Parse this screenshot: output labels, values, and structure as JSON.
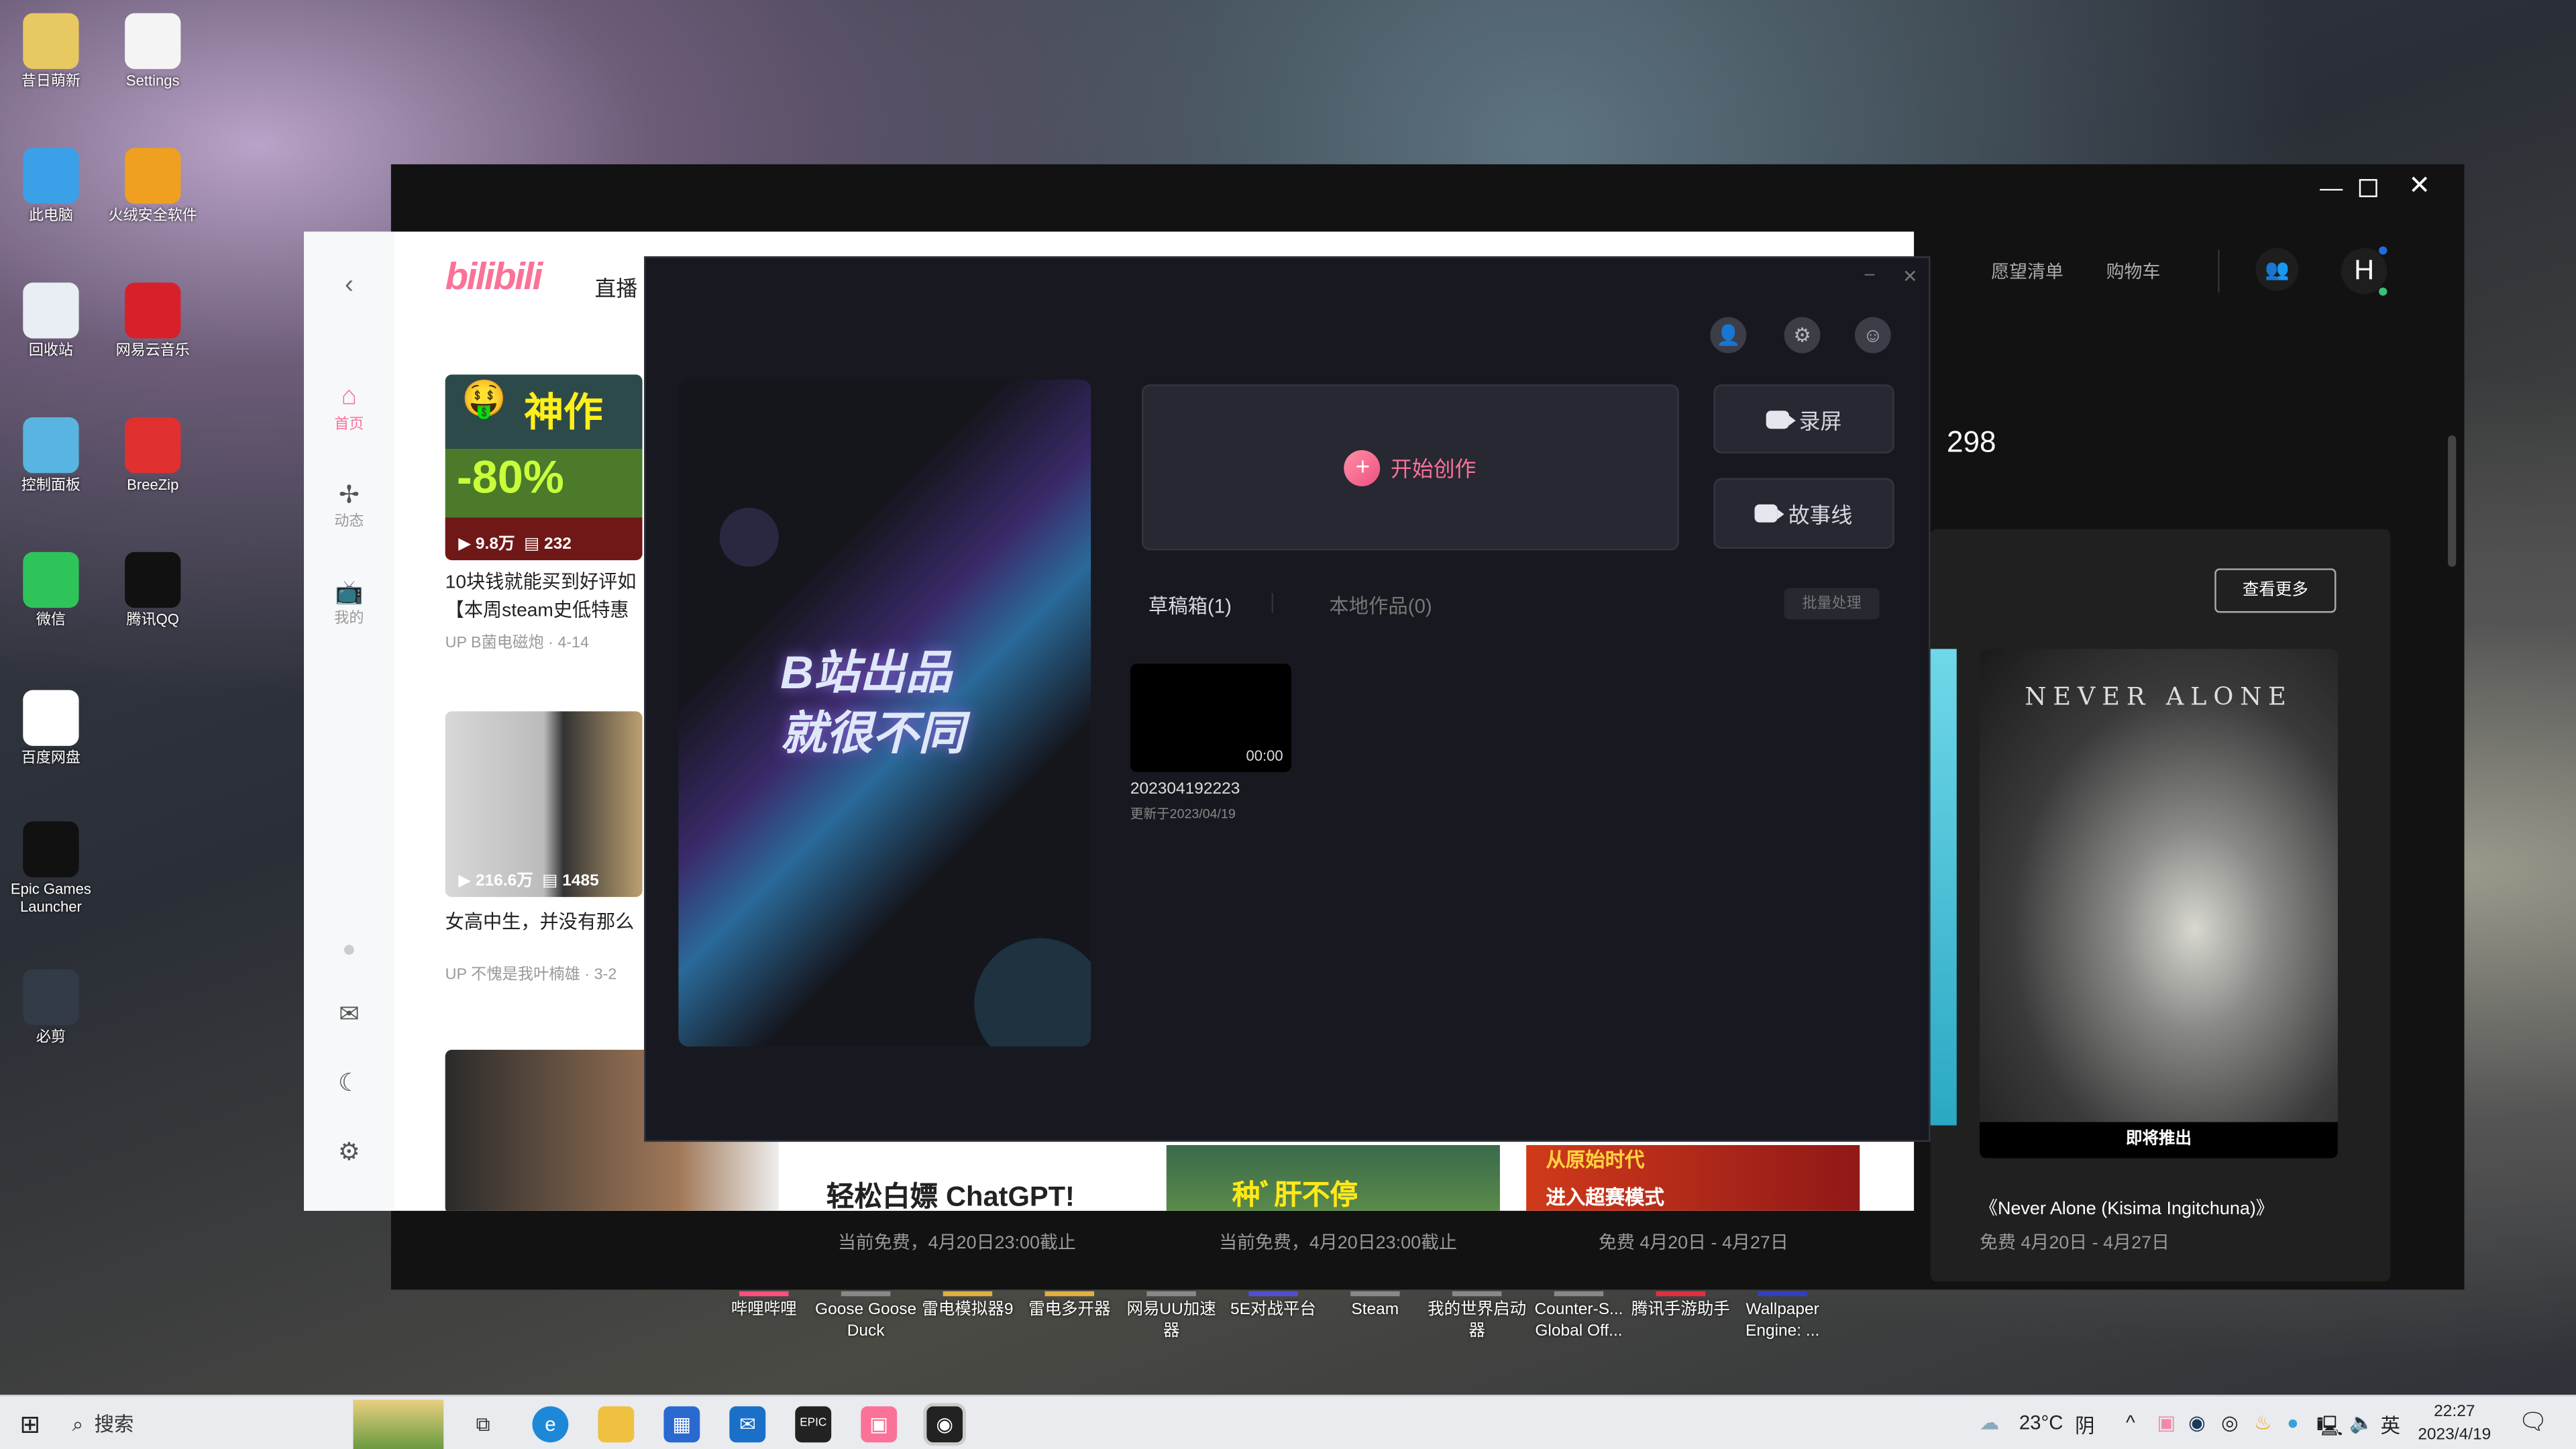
{
  "desktop": {
    "icons": [
      {
        "label": "昔日萌新",
        "color": "#e8c860"
      },
      {
        "label": "Settings",
        "color": "#f4f4f4"
      },
      {
        "label": "此电脑",
        "color": "#3aa0e8"
      },
      {
        "label": "火绒安全软件",
        "color": "#f0a020"
      },
      {
        "label": "回收站",
        "color": "#e8eef4"
      },
      {
        "label": "网易云音乐",
        "color": "#d8202a"
      },
      {
        "label": "控制面板",
        "color": "#58b4e0"
      },
      {
        "label": "BreeZip",
        "color": "#e03030"
      },
      {
        "label": "微信",
        "color": "#2ec45a"
      },
      {
        "label": "腾讯QQ",
        "color": "#111111"
      },
      {
        "label": "百度网盘",
        "color": "#ffffff"
      },
      {
        "label": "Epic Games Launcher",
        "color": "#111111"
      },
      {
        "label": "必剪",
        "color": "#333a48"
      }
    ],
    "dock": [
      {
        "label": "哔哩哔哩",
        "color": "#ff4f7c"
      },
      {
        "label": "Goose Goose Duck",
        "color": "#888"
      },
      {
        "label": "雷电模拟器9",
        "color": "#e0b040"
      },
      {
        "label": "雷电多开器",
        "color": "#e0b040"
      },
      {
        "label": "网易UU加速器",
        "color": "#888"
      },
      {
        "label": "5E对战平台",
        "color": "#5050d0"
      },
      {
        "label": "Steam",
        "color": "#888"
      },
      {
        "label": "我的世界启动器",
        "color": "#888"
      },
      {
        "label": "Counter-S... Global Off...",
        "color": "#888"
      },
      {
        "label": "腾讯手游助手",
        "color": "#e03040"
      },
      {
        "label": "Wallpaper Engine: ...",
        "color": "#3040c0"
      }
    ]
  },
  "epic": {
    "nav": [
      "愿望清单",
      "购物车"
    ],
    "avatar": "H",
    "price_fragment": "298",
    "view_more": "查看更多",
    "featured": {
      "badge": "即将推出",
      "title": "《Never Alone (Kisima Ingitchuna)》",
      "period": "免费 4月20日 - 4月27日"
    },
    "captions": [
      "当前免费，4月20日23:00截止",
      "当前免费，4月20日23:00截止",
      "免费 4月20日 - 4月27日"
    ]
  },
  "bilibili": {
    "logo": "bilibili",
    "nav_live": "直播",
    "sidebar": [
      {
        "label": "首页",
        "active": true
      },
      {
        "label": "动态"
      },
      {
        "label": "我的"
      }
    ],
    "cards": [
      {
        "thumb_top": "神作",
        "discount": "-80%",
        "views": "9.8万",
        "comments": "232",
        "title1": "10块钱就能买到好评如",
        "title2": "【本周steam史低特惠",
        "author": "B菌电磁炮",
        "date": "4-14"
      },
      {
        "views": "216.6万",
        "comments": "1485",
        "title1": "女高中生，并没有那么",
        "author": "不愧是我叶楠雄",
        "date": "3-2"
      }
    ],
    "strip": [
      "轻松白嫖 ChatGPT!",
      "种ﾞ肝不停",
      "从原始时代",
      "进入超赛模式"
    ]
  },
  "creator": {
    "banner_line1": "B站出品",
    "banner_line2": "就很不同",
    "start": "开始创作",
    "record": "录屏",
    "story": "故事线",
    "tabs": [
      {
        "label": "草稿箱(1)",
        "active": true
      },
      {
        "label": "本地作品(0)"
      }
    ],
    "batch": "批量处理",
    "drafts": [
      {
        "duration": "00:00",
        "name": "202304192223",
        "updated": "更新于2023/04/19"
      }
    ]
  },
  "taskbar": {
    "search": "搜索",
    "weather": "23°C",
    "weather_desc": "阴",
    "ime": "英",
    "time": "22:27",
    "date": "2023/4/19"
  }
}
